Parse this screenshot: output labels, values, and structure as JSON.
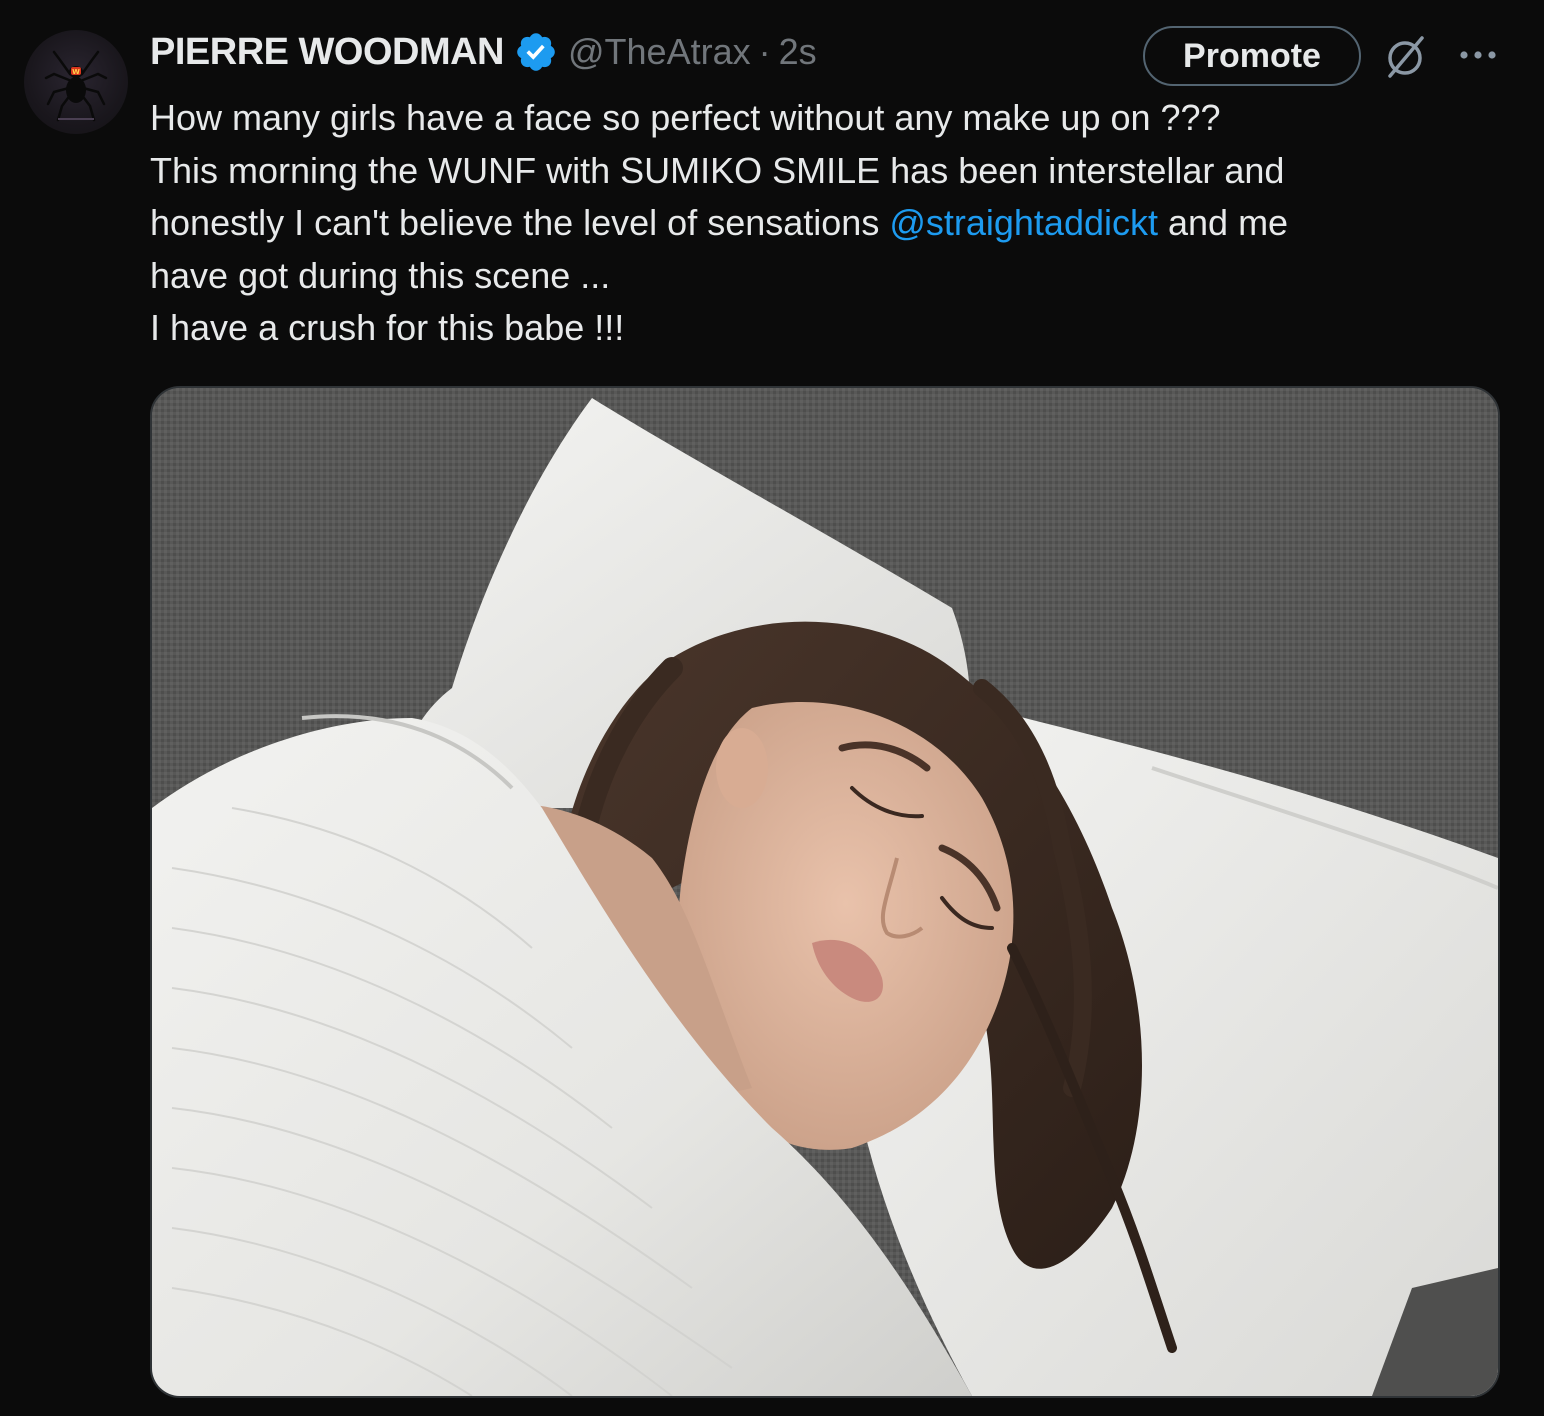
{
  "tweet": {
    "author": {
      "display_name": "PIERRE WOODMAN",
      "handle": "@TheAtrax",
      "verified": true,
      "avatar_icon": "spider-logo-icon",
      "avatar_logo_text": "W"
    },
    "separator": "·",
    "time": "2s",
    "promote_label": "Promote",
    "text_lines": [
      "How many girls have a face so perfect without any make up on ???",
      "This morning the WUNF with SUMIKO SMILE has been interstellar and",
      "honestly I can't believe the level of sensations ",
      "@straightaddickt",
      " and me",
      "have got during this scene ...",
      "I have a crush for this babe !!!"
    ],
    "media_icon": "photo-sleeping-woman-on-pillow"
  },
  "colors": {
    "background": "#0b0b0b",
    "text": "#e7e9ea",
    "secondary_text": "#71767b",
    "link": "#1d9bf0",
    "verified_badge": "#1d9bf0",
    "border": "#2f3336"
  }
}
